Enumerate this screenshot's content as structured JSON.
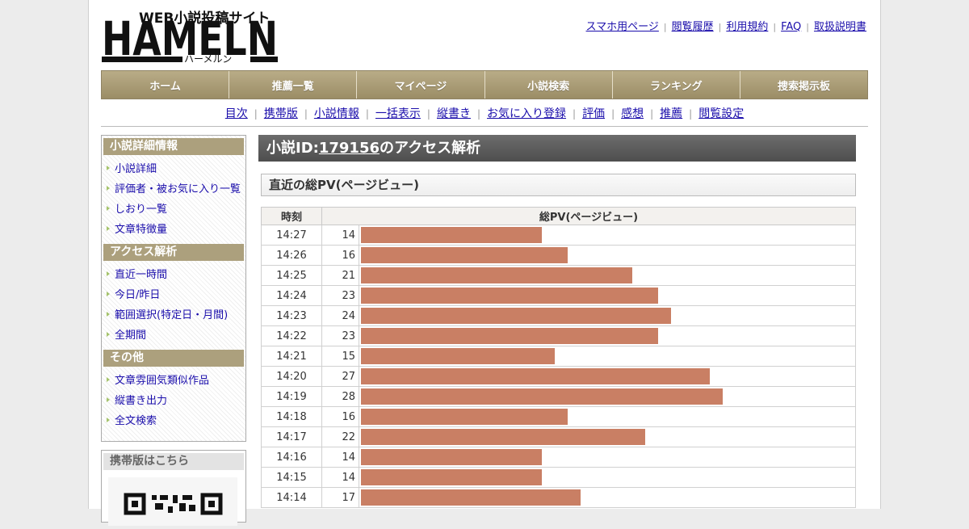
{
  "site": {
    "logo_text": "HAMELN",
    "logo_tagline": "WEB小説投稿サイト",
    "logo_kana": "ハーメルン"
  },
  "toplinks": [
    "スマホ用ページ",
    "閲覧履歴",
    "利用規約",
    "FAQ",
    "取扱説明書"
  ],
  "gnav": [
    "ホーム",
    "推薦一覧",
    "マイページ",
    "小説検索",
    "ランキング",
    "捜索掲示板"
  ],
  "subnav": [
    "目次",
    "携帯版",
    "小説情報",
    "一括表示",
    "縦書き",
    "お気に入り登録",
    "評価",
    "感想",
    "推薦",
    "閲覧設定"
  ],
  "sidebar": {
    "sections": [
      {
        "title": "小説詳細情報",
        "items": [
          "小説詳細",
          "評価者・被お気に入り一覧",
          "しおり一覧",
          "文章特徴量"
        ]
      },
      {
        "title": "アクセス解析",
        "items": [
          "直近一時間",
          "今日/昨日",
          "範囲選択(特定日・月間)",
          "全期間"
        ]
      },
      {
        "title": "その他",
        "items": [
          "文章雰囲気類似作品",
          "縦書き出力",
          "全文検索"
        ]
      }
    ],
    "mobile_title": "携帯版はこちら"
  },
  "main": {
    "title_prefix": "小説ID:",
    "novel_id": "179156",
    "title_suffix": "のアクセス解析",
    "section_title": "直近の総PV(ページビュー)",
    "col_time": "時刻",
    "col_pv": "総PV(ページビュー)"
  },
  "chart_data": {
    "type": "bar",
    "categories": [
      "14:27",
      "14:26",
      "14:25",
      "14:24",
      "14:23",
      "14:22",
      "14:21",
      "14:20",
      "14:19",
      "14:18",
      "14:17",
      "14:16",
      "14:15",
      "14:14"
    ],
    "values": [
      14,
      16,
      21,
      23,
      24,
      23,
      15,
      27,
      28,
      16,
      22,
      14,
      14,
      17
    ],
    "xlabel": "時刻",
    "ylabel": "総PV(ページビュー)",
    "bar_color": "#c97f64",
    "scale_max": 37.5
  },
  "colors": {
    "nav": "#a89b74",
    "sidebar_head": "#aca07d",
    "title_bar": "#5a5a5a",
    "link": "#1a0dab",
    "bar": "#c97f64",
    "arrow": "#a5c36c"
  }
}
